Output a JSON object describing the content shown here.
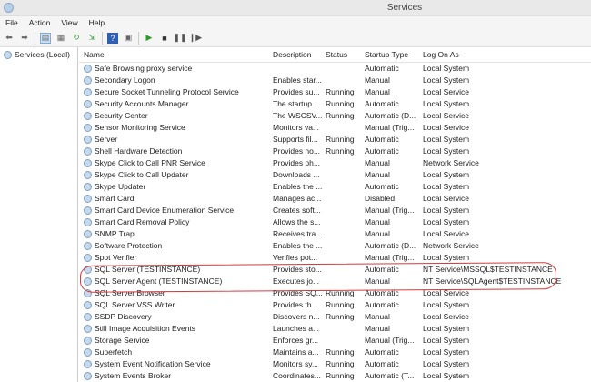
{
  "window": {
    "title": "Services"
  },
  "menu": [
    "File",
    "Action",
    "View",
    "Help"
  ],
  "left_pane": {
    "label": "Services (Local)"
  },
  "columns": {
    "name": "Name",
    "description": "Description",
    "status": "Status",
    "startup": "Startup Type",
    "logon": "Log On As"
  },
  "rows": [
    {
      "name": "Safe Browsing proxy service",
      "description": "",
      "status": "",
      "startup": "Automatic",
      "logon": "Local System"
    },
    {
      "name": "Secondary Logon",
      "description": "Enables star...",
      "status": "",
      "startup": "Manual",
      "logon": "Local System"
    },
    {
      "name": "Secure Socket Tunneling Protocol Service",
      "description": "Provides su...",
      "status": "Running",
      "startup": "Manual",
      "logon": "Local Service"
    },
    {
      "name": "Security Accounts Manager",
      "description": "The startup ...",
      "status": "Running",
      "startup": "Automatic",
      "logon": "Local System"
    },
    {
      "name": "Security Center",
      "description": "The WSCSV...",
      "status": "Running",
      "startup": "Automatic (D...",
      "logon": "Local Service"
    },
    {
      "name": "Sensor Monitoring Service",
      "description": "Monitors va...",
      "status": "",
      "startup": "Manual (Trig...",
      "logon": "Local Service"
    },
    {
      "name": "Server",
      "description": "Supports fil...",
      "status": "Running",
      "startup": "Automatic",
      "logon": "Local System"
    },
    {
      "name": "Shell Hardware Detection",
      "description": "Provides no...",
      "status": "Running",
      "startup": "Automatic",
      "logon": "Local System"
    },
    {
      "name": "Skype Click to Call PNR Service",
      "description": "Provides ph...",
      "status": "",
      "startup": "Manual",
      "logon": "Network Service"
    },
    {
      "name": "Skype Click to Call Updater",
      "description": "Downloads ...",
      "status": "",
      "startup": "Manual",
      "logon": "Local System"
    },
    {
      "name": "Skype Updater",
      "description": "Enables the ...",
      "status": "",
      "startup": "Automatic",
      "logon": "Local System"
    },
    {
      "name": "Smart Card",
      "description": "Manages ac...",
      "status": "",
      "startup": "Disabled",
      "logon": "Local Service"
    },
    {
      "name": "Smart Card Device Enumeration Service",
      "description": "Creates soft...",
      "status": "",
      "startup": "Manual (Trig...",
      "logon": "Local System"
    },
    {
      "name": "Smart Card Removal Policy",
      "description": "Allows the s...",
      "status": "",
      "startup": "Manual",
      "logon": "Local System"
    },
    {
      "name": "SNMP Trap",
      "description": "Receives tra...",
      "status": "",
      "startup": "Manual",
      "logon": "Local Service"
    },
    {
      "name": "Software Protection",
      "description": "Enables the ...",
      "status": "",
      "startup": "Automatic (D...",
      "logon": "Network Service"
    },
    {
      "name": "Spot Verifier",
      "description": "Verifies pot...",
      "status": "",
      "startup": "Manual (Trig...",
      "logon": "Local System"
    },
    {
      "name": "SQL Server (TESTINSTANCE)",
      "description": "Provides sto...",
      "status": "",
      "startup": "Automatic",
      "logon": "NT Service\\MSSQL$TESTINSTANCE"
    },
    {
      "name": "SQL Server Agent (TESTINSTANCE)",
      "description": "Executes jo...",
      "status": "",
      "startup": "Manual",
      "logon": "NT Service\\SQLAgent$TESTINSTANCE"
    },
    {
      "name": "SQL Server Browser",
      "description": "Provides SQ...",
      "status": "Running",
      "startup": "Automatic",
      "logon": "Local Service"
    },
    {
      "name": "SQL Server VSS Writer",
      "description": "Provides th...",
      "status": "Running",
      "startup": "Automatic",
      "logon": "Local System"
    },
    {
      "name": "SSDP Discovery",
      "description": "Discovers n...",
      "status": "Running",
      "startup": "Manual",
      "logon": "Local Service"
    },
    {
      "name": "Still Image Acquisition Events",
      "description": "Launches a...",
      "status": "",
      "startup": "Manual",
      "logon": "Local System"
    },
    {
      "name": "Storage Service",
      "description": "Enforces gr...",
      "status": "",
      "startup": "Manual (Trig...",
      "logon": "Local System"
    },
    {
      "name": "Superfetch",
      "description": "Maintains a...",
      "status": "Running",
      "startup": "Automatic",
      "logon": "Local System"
    },
    {
      "name": "System Event Notification Service",
      "description": "Monitors sy...",
      "status": "Running",
      "startup": "Automatic",
      "logon": "Local System"
    },
    {
      "name": "System Events Broker",
      "description": "Coordinates...",
      "status": "Running",
      "startup": "Automatic (T...",
      "logon": "Local System"
    }
  ]
}
